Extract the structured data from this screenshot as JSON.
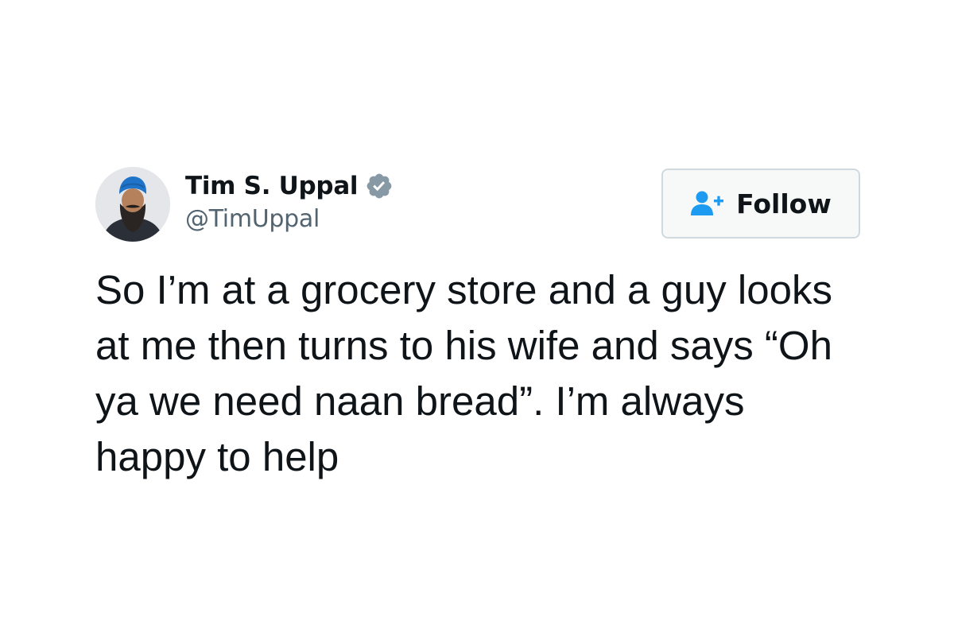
{
  "tweet": {
    "author": {
      "display_name": "Tim S. Uppal",
      "handle": "@TimUppal",
      "verified": true
    },
    "follow_button": {
      "label": "Follow"
    },
    "text": "So I’m at a grocery store and a guy looks at me then turns to his wife and says “Oh ya we need naan bread”. I’m always happy to help"
  },
  "colors": {
    "text_primary": "#0f1419",
    "text_secondary": "#536471",
    "verified_badge": "#8899a6",
    "follow_icon": "#1d9bf0",
    "avatar_turban": "#1f73c8"
  },
  "icons": {
    "verified": "verified-badge-icon",
    "follow": "add-user-icon"
  }
}
